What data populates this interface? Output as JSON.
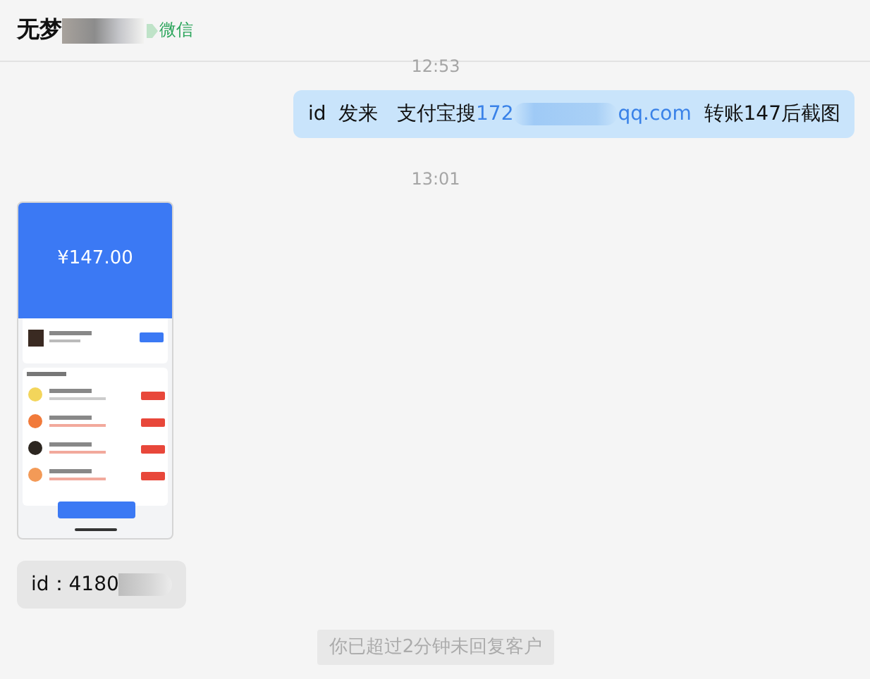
{
  "header": {
    "title_parts": [
      {
        "kind": "text",
        "text": "无梦"
      },
      {
        "kind": "redacted"
      }
    ],
    "source": "微信"
  },
  "messages": [
    {
      "kind": "time",
      "text": "12:53"
    },
    {
      "kind": "bubble",
      "outgoing": true,
      "parts": [
        {
          "kind": "text",
          "text": "id  发来   支付宝搜"
        },
        {
          "kind": "link",
          "text": "172"
        },
        {
          "kind": "redacted"
        },
        {
          "kind": "link",
          "text": "qq.com"
        },
        {
          "kind": "text",
          "text": "  转账147后截图"
        }
      ]
    },
    {
      "kind": "time",
      "text": "13:01"
    },
    {
      "kind": "image",
      "outgoing": false,
      "amount": "¥147.00"
    },
    {
      "kind": "bubble",
      "outgoing": false,
      "parts": [
        {
          "kind": "text",
          "text": "id：4180"
        },
        {
          "kind": "redacted"
        }
      ]
    },
    {
      "kind": "notice",
      "text": "你已超过2分钟未回复客户"
    }
  ]
}
